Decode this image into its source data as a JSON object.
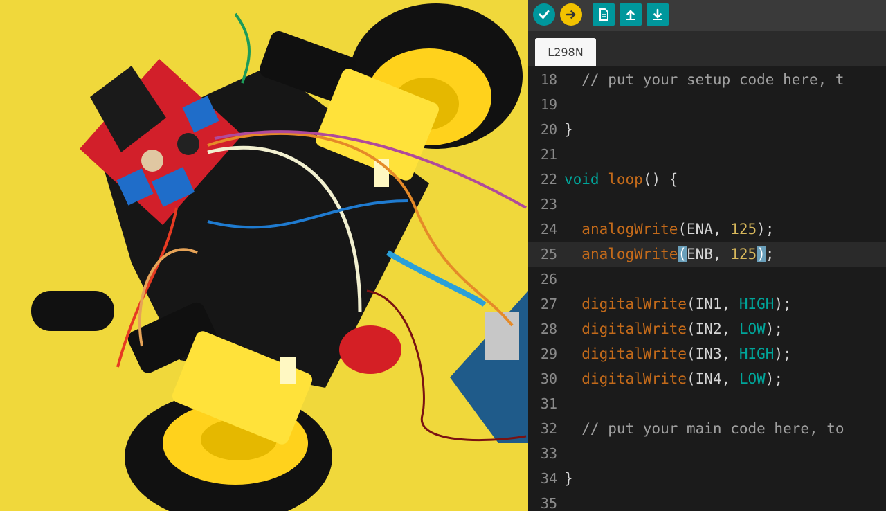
{
  "toolbar": {
    "buttons": [
      {
        "name": "verify-button",
        "icon": "checkmark-icon",
        "color": "#00979c"
      },
      {
        "name": "upload-button",
        "icon": "arrow-right-icon",
        "color": "#f2c200"
      },
      {
        "name": "new-sketch-button",
        "icon": "new-file-icon",
        "color": "#00979c"
      },
      {
        "name": "open-sketch-button",
        "icon": "arrow-up-icon",
        "color": "#00979c"
      },
      {
        "name": "save-sketch-button",
        "icon": "arrow-down-icon",
        "color": "#00979c"
      }
    ]
  },
  "tab": {
    "label": "L298N"
  },
  "editor": {
    "lines": [
      {
        "n": "18",
        "parts": [
          {
            "t": "  // put your setup code here, t",
            "c": "cmt"
          }
        ]
      },
      {
        "n": "19",
        "parts": []
      },
      {
        "n": "20",
        "parts": [
          {
            "t": "}",
            "c": "plain"
          }
        ]
      },
      {
        "n": "21",
        "parts": []
      },
      {
        "n": "22",
        "parts": [
          {
            "t": "void",
            "c": "kw"
          },
          {
            "t": " ",
            "c": "plain"
          },
          {
            "t": "loop",
            "c": "fn"
          },
          {
            "t": "() {",
            "c": "plain"
          }
        ]
      },
      {
        "n": "23",
        "parts": []
      },
      {
        "n": "24",
        "parts": [
          {
            "t": "  ",
            "c": "plain"
          },
          {
            "t": "analogWrite",
            "c": "fn"
          },
          {
            "t": "(ENA, ",
            "c": "plain"
          },
          {
            "t": "125",
            "c": "num"
          },
          {
            "t": ");",
            "c": "plain"
          }
        ]
      },
      {
        "n": "25",
        "active": true,
        "parts": [
          {
            "t": "  ",
            "c": "plain"
          },
          {
            "t": "analogWrite",
            "c": "fn"
          },
          {
            "t": "(",
            "c": "cursor"
          },
          {
            "t": "ENB, ",
            "c": "plain"
          },
          {
            "t": "125",
            "c": "num"
          },
          {
            "t": ")",
            "c": "cursor"
          },
          {
            "t": ";",
            "c": "plain"
          }
        ]
      },
      {
        "n": "26",
        "parts": []
      },
      {
        "n": "27",
        "parts": [
          {
            "t": "  ",
            "c": "plain"
          },
          {
            "t": "digitalWrite",
            "c": "fn"
          },
          {
            "t": "(IN1, ",
            "c": "plain"
          },
          {
            "t": "HIGH",
            "c": "const"
          },
          {
            "t": ");",
            "c": "plain"
          }
        ]
      },
      {
        "n": "28",
        "parts": [
          {
            "t": "  ",
            "c": "plain"
          },
          {
            "t": "digitalWrite",
            "c": "fn"
          },
          {
            "t": "(IN2, ",
            "c": "plain"
          },
          {
            "t": "LOW",
            "c": "const"
          },
          {
            "t": ");",
            "c": "plain"
          }
        ]
      },
      {
        "n": "29",
        "parts": [
          {
            "t": "  ",
            "c": "plain"
          },
          {
            "t": "digitalWrite",
            "c": "fn"
          },
          {
            "t": "(IN3, ",
            "c": "plain"
          },
          {
            "t": "HIGH",
            "c": "const"
          },
          {
            "t": ");",
            "c": "plain"
          }
        ]
      },
      {
        "n": "30",
        "parts": [
          {
            "t": "  ",
            "c": "plain"
          },
          {
            "t": "digitalWrite",
            "c": "fn"
          },
          {
            "t": "(IN4, ",
            "c": "plain"
          },
          {
            "t": "LOW",
            "c": "const"
          },
          {
            "t": ");",
            "c": "plain"
          }
        ]
      },
      {
        "n": "31",
        "parts": []
      },
      {
        "n": "32",
        "parts": [
          {
            "t": "  // put your main code here, to",
            "c": "cmt"
          }
        ]
      },
      {
        "n": "33",
        "parts": []
      },
      {
        "n": "34",
        "parts": [
          {
            "t": "}",
            "c": "plain"
          }
        ]
      },
      {
        "n": "35",
        "parts": []
      }
    ]
  }
}
